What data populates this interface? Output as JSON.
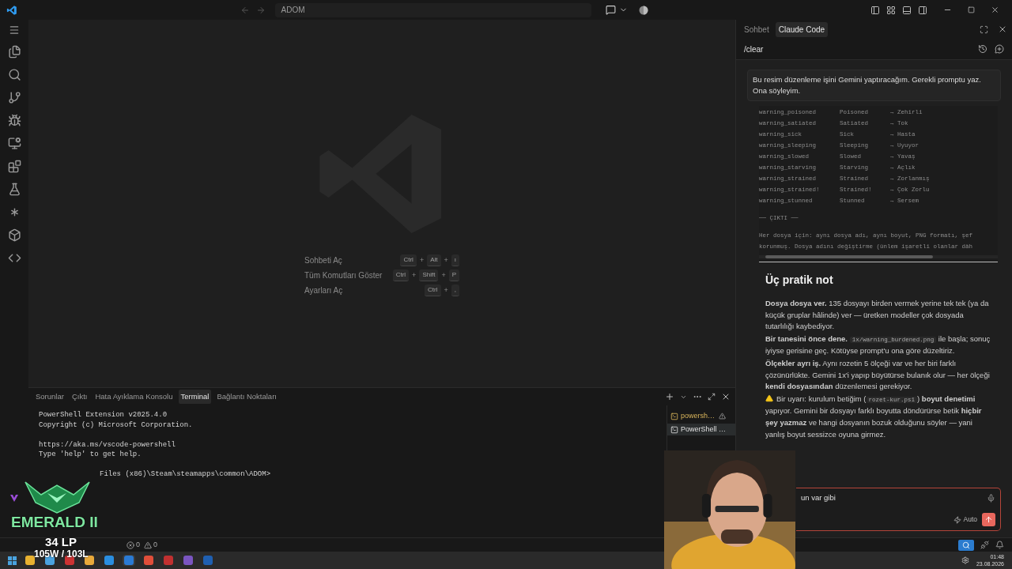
{
  "title_bar": {
    "title": "ADOM"
  },
  "editor": {
    "key_separator": "+",
    "shortcuts": [
      {
        "label": "Sohbeti Aç",
        "keys": [
          "Ctrl",
          "Alt",
          "ı"
        ]
      },
      {
        "label": "Tüm Komutları Göster",
        "keys": [
          "Ctrl",
          "Shift",
          "P"
        ]
      },
      {
        "label": "Ayarları Aç",
        "keys": [
          "Ctrl",
          ","
        ]
      }
    ]
  },
  "panel": {
    "tabs": [
      {
        "label": "Sorunlar",
        "selected": false
      },
      {
        "label": "Çıktı",
        "selected": false
      },
      {
        "label": "Hata Ayıklama Konsolu",
        "selected": false
      },
      {
        "label": "Terminal",
        "selected": true
      },
      {
        "label": "Bağlantı Noktaları",
        "selected": false
      }
    ],
    "terminal_blocks": [
      [
        "PowerShell Extension v2025.4.0",
        "Copyright (c) Microsoft Corporation."
      ],
      [
        "https://aka.ms/vscode-powershell",
        "Type 'help' to get help."
      ],
      [
        "Files (x86)\\Steam\\steamapps\\common\\ADOM>"
      ]
    ],
    "sessions": [
      {
        "label": "powersh…",
        "warning": true,
        "selected": false
      },
      {
        "label": "PowerShell …",
        "warning": false,
        "selected": true
      }
    ]
  },
  "chat": {
    "tabs": [
      {
        "label": "Sohbet",
        "selected": false
      },
      {
        "label": "Claude Code",
        "selected": true
      }
    ],
    "title": "/clear",
    "user_message": "Bu resim düzenleme işini Gemini yaptıracağım. Gerekli promptu yaz. Ona söyleyim.",
    "table_rows": [
      [
        "warning_poisoned",
        "Poisoned",
        "→ Zehirli"
      ],
      [
        "warning_satiated",
        "Satiated",
        "→ Tok"
      ],
      [
        "warning_sick",
        "Sick",
        "→ Hasta"
      ],
      [
        "warning_sleeping",
        "Sleeping",
        "→ Uyuyor"
      ],
      [
        "warning_slowed",
        "Slowed",
        "→ Yavaş"
      ],
      [
        "warning_starving",
        "Starving",
        "→ Açlık"
      ],
      [
        "warning_strained",
        "Strained",
        "→ Zorlanmış"
      ],
      [
        "warning_strained!",
        "Strained!",
        "→ Çok Zorlu"
      ],
      [
        "warning_stunned",
        "Stunned",
        "→ Sersem"
      ]
    ],
    "section_label": "── ÇIKTI ──",
    "output_lines": [
      "Her dosya için: aynı dosya adı, aynı boyut, PNG formatı, şef",
      "korunmuş. Dosya adını değiştirme (ünlem işaretli olanlar däh"
    ],
    "heading": "Üç pratik not",
    "notes": [
      {
        "kind": "text",
        "parts": [
          {
            "kind": "text",
            "text": "**Dosya dosya ver.** 135 dosyayı birden vermek yerine tek tek (ya da küçük gruplar hâlinde) ver — üretken modeller çok dosyada tutarlılığı kaybediyor."
          }
        ]
      },
      {
        "kind": "text",
        "parts": [
          {
            "kind": "text",
            "text": "**Bir tanesini önce dene.** "
          },
          {
            "kind": "code",
            "text": "1x/warning_burdened.png"
          },
          {
            "kind": "text",
            "text": " ile başla; sonuç iyiyse gerisine geç. Kötüyse prompt'u ona göre düzeltiriz."
          }
        ]
      },
      {
        "kind": "text",
        "parts": [
          {
            "kind": "text",
            "text": "**Ölçekler ayrı iş.** Aynı rozetin 5 ölçeği var ve her biri farklı çözünürlükte. Gemini 1x'i yapıp büyütürse bulanık olur — her ölçeği **kendi dosyasından** düzenlemesi gerekiyor."
          }
        ]
      },
      {
        "kind": "warning",
        "parts": [
          {
            "kind": "text",
            "text": "Bir uyarı: kurulum betiğim ("
          },
          {
            "kind": "code",
            "text": "rozet-kur.ps1"
          },
          {
            "kind": "text",
            "text": ") **boyut denetimi** yapıyor. Gemini bir dosyayı farklı boyutta döndürürse betik **hiçbir şey yazmaz** ve hangi dosyanın bozuk olduğunu söyler — yani yanlış boyut sessizce oyuna girmez."
          }
        ]
      }
    ],
    "input": {
      "value": "un var gibi"
    },
    "mode": "Auto"
  },
  "overlay": {
    "rank": "EMERALD II",
    "lp": "34 LP",
    "record": "105W / 103L"
  },
  "status_bar": {
    "errors": "0",
    "warnings": "0"
  },
  "taskbar": {
    "time": "01:48",
    "date": "23.08.2026"
  }
}
